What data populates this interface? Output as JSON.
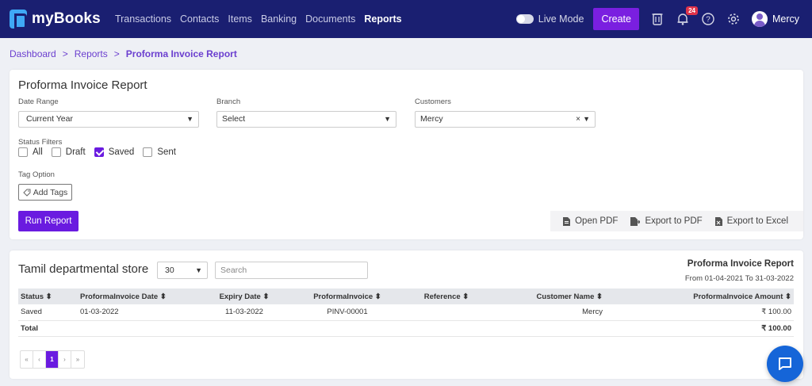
{
  "app": {
    "name": "myBooks"
  },
  "nav": {
    "links": [
      "Transactions",
      "Contacts",
      "Items",
      "Banking",
      "Documents",
      "Reports"
    ],
    "active": "Reports",
    "live_mode_label": "Live Mode",
    "create_label": "Create",
    "notification_count": "24",
    "user_name": "Mercy"
  },
  "breadcrumb": {
    "items": [
      "Dashboard",
      "Reports",
      "Proforma Invoice Report"
    ]
  },
  "filters": {
    "title": "Proforma Invoice Report",
    "date_range_label": "Date Range",
    "date_range_value": "Current Year",
    "branch_label": "Branch",
    "branch_value": "Select",
    "customers_label": "Customers",
    "customers_value": "Mercy",
    "clear_symbol": "×",
    "status_label": "Status Filters",
    "statuses": [
      {
        "label": "All",
        "checked": false
      },
      {
        "label": "Draft",
        "checked": false
      },
      {
        "label": "Saved",
        "checked": true
      },
      {
        "label": "Sent",
        "checked": false
      }
    ],
    "tag_label": "Tag Option",
    "add_tags_label": "Add Tags",
    "run_report_label": "Run Report",
    "export": {
      "open_pdf": "Open PDF",
      "export_pdf": "Export to PDF",
      "export_excel": "Export to Excel"
    }
  },
  "report": {
    "store_name": "Tamil departmental store",
    "page_size": "30",
    "search_placeholder": "Search",
    "title": "Proforma Invoice Report",
    "range": "From 01-04-2021 To 31-03-2022",
    "columns": [
      "Status ⬍",
      "ProformaInvoice Date ⬍",
      "Expiry Date ⬍",
      "ProformaInvoice ⬍",
      "Reference ⬍",
      "Customer Name ⬍",
      "ProformaInvoice Amount ⬍"
    ],
    "rows": [
      {
        "status": "Saved",
        "date": "01-03-2022",
        "expiry": "11-03-2022",
        "invoice": "PINV-00001",
        "reference": "",
        "customer": "Mercy",
        "amount": "₹ 100.00"
      }
    ],
    "total_label": "Total",
    "total_amount": "₹ 100.00",
    "pager": [
      "«",
      "‹",
      "1",
      "›",
      "»"
    ]
  },
  "colors": {
    "nav_bg": "#1a1f71",
    "accent": "#6a1be0",
    "chat": "#1565d8"
  }
}
